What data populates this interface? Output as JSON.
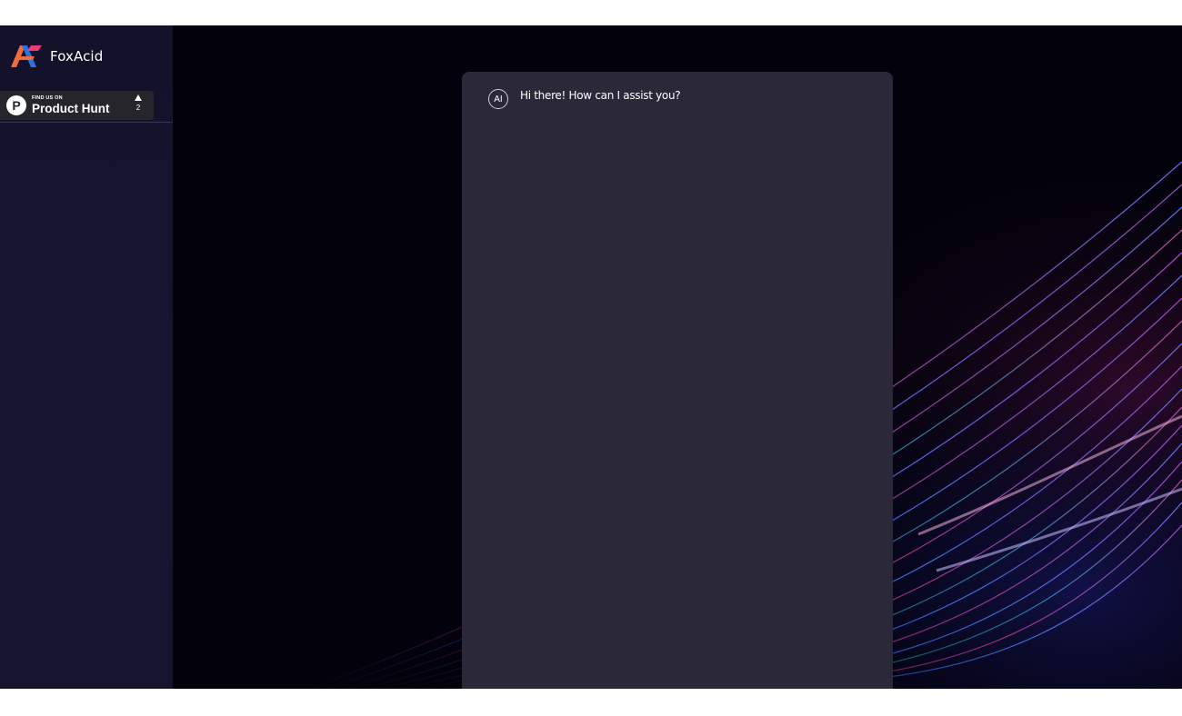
{
  "app": {
    "brand_name": "FoxAcid",
    "logo_icon": "foxacid-logo-icon",
    "colors": {
      "sidebar_bg": "#16132e",
      "chat_panel_bg": "#2b2839",
      "backdrop_bg": "#03020c",
      "logo_orange": "#f26b3a",
      "logo_blue": "#2f6fe0",
      "logo_pink": "#e83d7a"
    }
  },
  "sidebar": {
    "product_hunt": {
      "kicker": "FIND US ON",
      "title": "Product Hunt",
      "logo_letter": "P",
      "upvote_icon": "upvote-arrow-icon",
      "votes": "2"
    }
  },
  "chat": {
    "messages": [
      {
        "sender": "AI",
        "avatar_label": "AI",
        "text": "Hi there! How can I assist you?"
      }
    ]
  }
}
